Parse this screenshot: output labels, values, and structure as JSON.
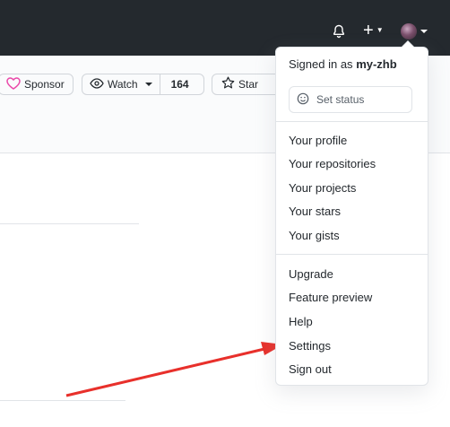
{
  "header": {
    "icons": [
      "bell-icon",
      "plus-icon",
      "avatar"
    ]
  },
  "repo_actions": {
    "sponsor_label": "Sponsor",
    "watch_label": "Watch",
    "watch_count": "164",
    "star_label": "Star"
  },
  "user_menu": {
    "signed_in_prefix": "Signed in as",
    "username": "my-zhb",
    "set_status_label": "Set status",
    "section1": [
      "Your profile",
      "Your repositories",
      "Your projects",
      "Your stars",
      "Your gists"
    ],
    "section2": [
      "Upgrade",
      "Feature preview",
      "Help",
      "Settings",
      "Sign out"
    ]
  },
  "colors": {
    "header_bg": "#24292e",
    "annotation_arrow": "#e8302b",
    "sponsor_heart": "#ea4aaa"
  }
}
